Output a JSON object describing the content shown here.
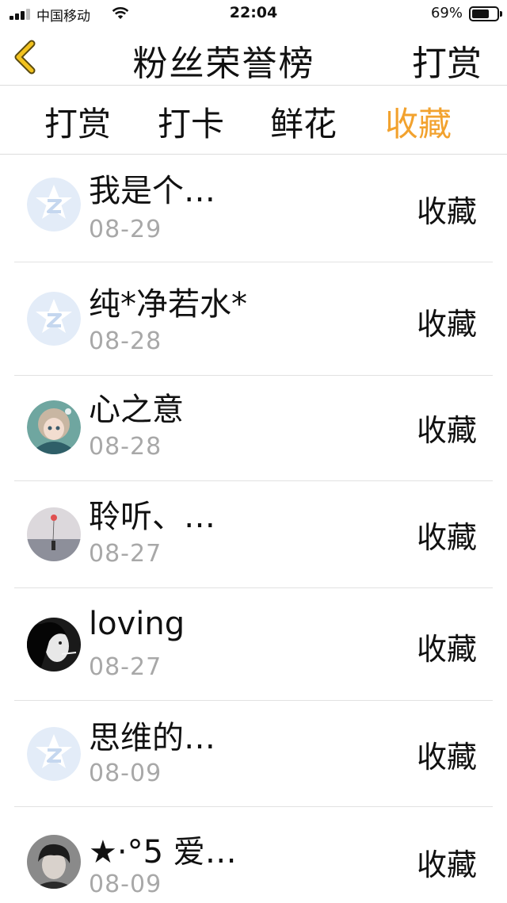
{
  "status_bar": {
    "carrier": "中国移动",
    "time": "22:04",
    "battery": "69%",
    "battery_level": 0.69
  },
  "nav": {
    "title": "粉丝荣誉榜",
    "action": "打赏"
  },
  "tabs": [
    {
      "label": "打赏",
      "active": false
    },
    {
      "label": "打卡",
      "active": false
    },
    {
      "label": "鲜花",
      "active": false
    },
    {
      "label": "收藏",
      "active": true
    }
  ],
  "colors": {
    "accent": "#f2a22e",
    "back_icon": "#f2c21e",
    "muted_text": "#a8a8a8"
  },
  "fans": [
    {
      "name": "我是个…",
      "date": "08-29",
      "action": "收藏",
      "avatar": "default-qq-avatar-icon"
    },
    {
      "name": "纯*净若水*",
      "date": "08-28",
      "action": "收藏",
      "avatar": "default-qq-avatar-icon"
    },
    {
      "name": "心之意",
      "date": "08-28",
      "action": "收藏",
      "avatar": "anime-girl-avatar"
    },
    {
      "name": "聆听、…",
      "date": "08-27",
      "action": "收藏",
      "avatar": "seaside-balloon-avatar"
    },
    {
      "name": "loving",
      "date": "08-27",
      "action": "收藏",
      "avatar": "dark-portrait-avatar"
    },
    {
      "name": "思维的…",
      "date": "08-09",
      "action": "收藏",
      "avatar": "default-qq-avatar-icon"
    },
    {
      "name": "★·°5 爱…",
      "date": "08-09",
      "action": "收藏",
      "avatar": "boy-portrait-avatar"
    }
  ]
}
